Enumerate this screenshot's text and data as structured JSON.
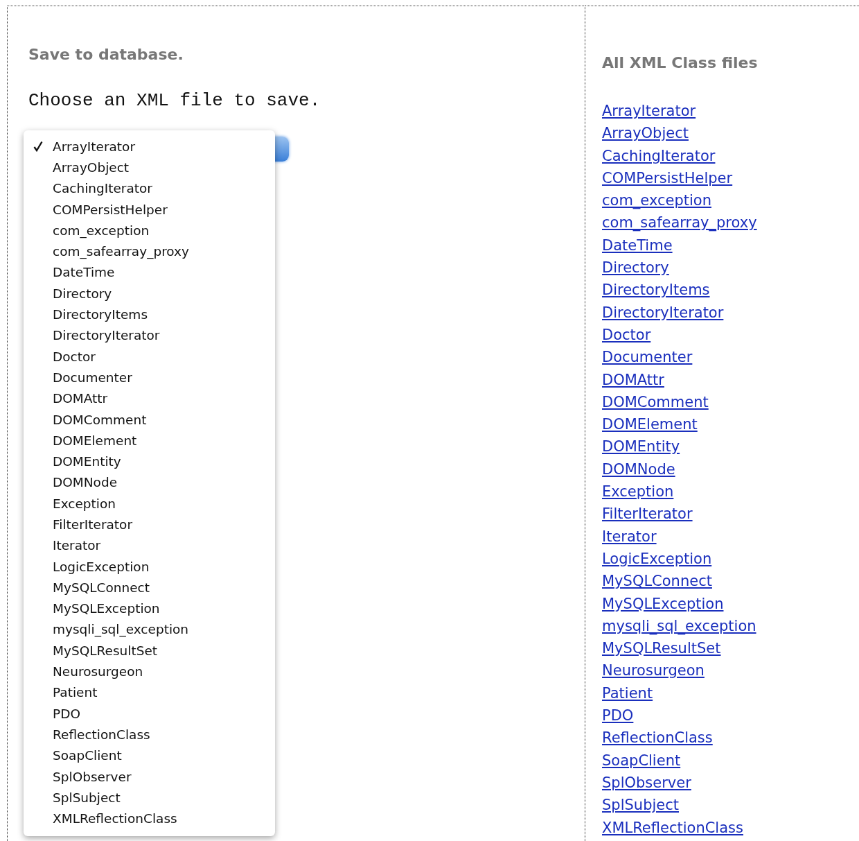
{
  "save_panel": {
    "heading": "Save to database.",
    "prompt": "Choose an XML file to save.",
    "dropdown": {
      "expanded": true,
      "options": [
        {
          "label": "ArrayIterator",
          "selected": true
        },
        {
          "label": "ArrayObject",
          "selected": false
        },
        {
          "label": "CachingIterator",
          "selected": false
        },
        {
          "label": "COMPersistHelper",
          "selected": false
        },
        {
          "label": "com_exception",
          "selected": false
        },
        {
          "label": "com_safearray_proxy",
          "selected": false
        },
        {
          "label": "DateTime",
          "selected": false
        },
        {
          "label": "Directory",
          "selected": false
        },
        {
          "label": "DirectoryItems",
          "selected": false
        },
        {
          "label": "DirectoryIterator",
          "selected": false
        },
        {
          "label": "Doctor",
          "selected": false
        },
        {
          "label": "Documenter",
          "selected": false
        },
        {
          "label": "DOMAttr",
          "selected": false
        },
        {
          "label": "DOMComment",
          "selected": false
        },
        {
          "label": "DOMElement",
          "selected": false
        },
        {
          "label": "DOMEntity",
          "selected": false
        },
        {
          "label": "DOMNode",
          "selected": false
        },
        {
          "label": "Exception",
          "selected": false
        },
        {
          "label": "FilterIterator",
          "selected": false
        },
        {
          "label": "Iterator",
          "selected": false
        },
        {
          "label": "LogicException",
          "selected": false
        },
        {
          "label": "MySQLConnect",
          "selected": false
        },
        {
          "label": "MySQLException",
          "selected": false
        },
        {
          "label": "mysqli_sql_exception",
          "selected": false
        },
        {
          "label": "MySQLResultSet",
          "selected": false
        },
        {
          "label": "Neurosurgeon",
          "selected": false
        },
        {
          "label": "Patient",
          "selected": false
        },
        {
          "label": "PDO",
          "selected": false
        },
        {
          "label": "ReflectionClass",
          "selected": false
        },
        {
          "label": "SoapClient",
          "selected": false
        },
        {
          "label": "SplObserver",
          "selected": false
        },
        {
          "label": "SplSubject",
          "selected": false
        },
        {
          "label": "XMLReflectionClass",
          "selected": false
        }
      ]
    }
  },
  "class_panel": {
    "heading": "All XML Class files",
    "links": [
      "ArrayIterator",
      "ArrayObject",
      "CachingIterator",
      "COMPersistHelper",
      "com_exception",
      "com_safearray_proxy",
      "DateTime",
      "Directory",
      "DirectoryItems",
      "DirectoryIterator",
      "Doctor",
      "Documenter",
      "DOMAttr",
      "DOMComment",
      "DOMElement",
      "DOMEntity",
      "DOMNode",
      "Exception",
      "FilterIterator",
      "Iterator",
      "LogicException",
      "MySQLConnect",
      "MySQLException",
      "mysqli_sql_exception",
      "MySQLResultSet",
      "Neurosurgeon",
      "Patient",
      "PDO",
      "ReflectionClass",
      "SoapClient",
      "SplObserver",
      "SplSubject",
      "XMLReflectionClass"
    ]
  }
}
